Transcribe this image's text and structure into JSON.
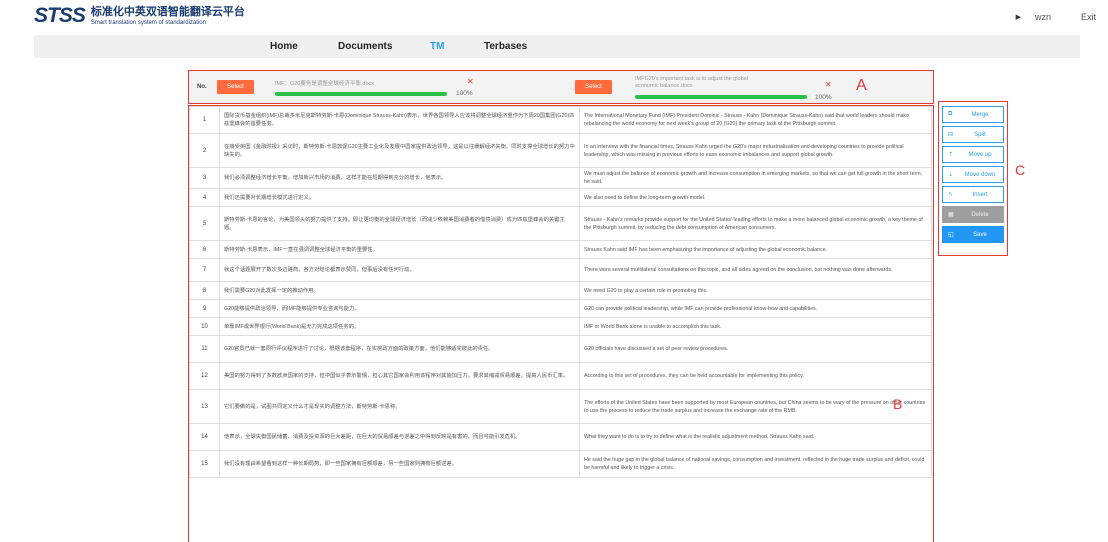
{
  "header": {
    "logo_mark": "STSS",
    "title_cn": "标准化中英双语智能翻译云平台",
    "title_en": "Smart translation system of standardization",
    "user": "wzn",
    "exit_label": "Exit"
  },
  "nav": {
    "items": [
      {
        "label": "Home"
      },
      {
        "label": "Documents"
      },
      {
        "label": "TM"
      },
      {
        "label": "Terbases"
      }
    ],
    "active": "TM"
  },
  "files": {
    "no_label": "No.",
    "source": {
      "select_label": "Select",
      "name": "IMF：G20要务是调整全球经济平衡.docx",
      "progress_text": "100%",
      "progress": 1.0
    },
    "target": {
      "select_label": "Select",
      "name": "IMFG20's important task is to adjust the global economic balance.docx",
      "progress_text": "100%",
      "progress": 1.0
    },
    "annotation": "A"
  },
  "table": {
    "annotation": "B",
    "rows": [
      {
        "no": "1",
        "src": "国际货币基金组织(IMF)总裁多米尼克斯特劳斯-卡恩(Dominique Strauss-Kahn)表示，世界各国领导人应该将调整全球经济重作为下周20国集团(G20)匹兹堡峰会的首要任务。",
        "tgt": "The International Monetary Fund (IMF) President Dominic - Strauss - Kahn (Dominique Strauss-Kahn) said that world leaders should make rebalancing the world economy for next week's group of 20 (G20) the primary task of the Pittsburgh summit."
      },
      {
        "no": "2",
        "src": "在接受英国《金融时报》采访时，斯特劳斯-卡恩敦促G20主要工业化及发展中国家提供政治领导，这是以往缓解经济失衡、同时支撑全球增长的努力中缺失的。",
        "tgt": "In an interview with the financial times, Strauss Kahn urged the G20's major industrialisation and developing countries to provide political leadership, which was missing in previous efforts to ease economic imbalances and support global growth."
      },
      {
        "no": "3",
        "src": "我们必须调整经济增长平衡，增加新兴市场的消费，这样才能在短期得到充分的增长，他表示。",
        "tgt": "We must adjust the balance of economic growth and increase consumption in emerging markets, so that we can get full growth in the short term, he said."
      },
      {
        "no": "4",
        "src": "我们还需要对长期增长模式进行定义。",
        "tgt": "We also need to define the long-term growth model."
      },
      {
        "no": "5",
        "src": "斯特劳斯-卡恩的言论，为美国领头的努力提供了支持，即让更均衡的全球经济增长（而减少依赖美国消费者的借债消费）成为匹兹堡峰会的关键主题。",
        "tgt": "Strauss - Kahn's remarks provide support for the United States' leading efforts to make a more balanced global economic growth, a key theme of the Pittsburgh summit, by reducing the debt consumption of American consumers."
      },
      {
        "no": "6",
        "src": "斯特劳斯-卡恩表示，IMF一直在强调调整全球经济平衡的重要性。",
        "tgt": "Strauss Kahn said IMF has been emphasizing the importance of adjusting the global economic balance."
      },
      {
        "no": "7",
        "src": "就这个话题展开了数次多边磋商，各方对结论都表示赞同，但事后没有任何行动。",
        "tgt": "There were several multilateral consultations on this topic, and all sides agreed on the conclusion, but nothing was done afterwards."
      },
      {
        "no": "8",
        "src": "我们需要G20对此发挥一定的推动作用。",
        "tgt": "We need G20 to play a certain role in promoting this."
      },
      {
        "no": "9",
        "src": "G20能够提供政治领导，而IMF能够提供专业咨询与能力。",
        "tgt": "G20 can provide political leadership, while IMF can provide professional know-how and capabilities."
      },
      {
        "no": "10",
        "src": "单靠IMF或世界银行(World Bank)是无力完成这项任务的。",
        "tgt": "IMF or World Bank alone is unable to accomplish this task."
      },
      {
        "no": "11",
        "src": "G20官员已就一套同行评议程序进行了讨论，根据该套程序，在实施政方面的政策方面，他们能够适完彼此的责任。",
        "tgt": "G20 officials have discussed a set of peer review procedures."
      },
      {
        "no": "12",
        "src": "美国的努力得到了多数欧洲国家的支持，但中国似乎表示警惕，担心其它国家会利用该程序对其施加压力，要求其缩减贸易顺差，提高人民币汇率。",
        "tgt": "According to this set of procedures, they can be held accountable for implementing this policy."
      },
      {
        "no": "13",
        "src": "它们要做的是，试图共同定义什么才是现实的调整方法，斯特劳斯-卡恩称。",
        "tgt": "The efforts of the United States have been supported by most European countries, but China seems to be wary of the pressure on other countries to use the process to reduce the trade surplus and increase the exchange rate of the RMB."
      },
      {
        "no": "14",
        "src": "他表示，全球失衡国民储蓄、消费及投资源的巨大差距，在巨大的贸易顺差与逆差之中得到反映是有害的，而且可能引发危机。",
        "tgt": "What they want to do is to try to define what is the realistic adjustment method, Strauss Kahn said."
      },
      {
        "no": "15",
        "src": "我们没有理由希望看到这样一种长期局势，即一些国家拥有巨额顺差，另一些国家则拥有巨额逆差。",
        "tgt": "He said the huge gap in the global balance of national savings, consumption and investment, reflected in the huge trade surplus and deficit, could be harmful and likely to trigger a crisis."
      }
    ]
  },
  "side": {
    "annotation": "C",
    "buttons": [
      {
        "label": "Merge",
        "icon": "merge-icon",
        "glyph": "⧉"
      },
      {
        "label": "Split",
        "icon": "split-icon",
        "glyph": "⊟"
      },
      {
        "label": "Move up",
        "icon": "move-up-icon",
        "glyph": "⇡"
      },
      {
        "label": "Move down",
        "icon": "move-down-icon",
        "glyph": "⇣"
      },
      {
        "label": "Insert",
        "icon": "insert-icon",
        "glyph": "↖"
      },
      {
        "label": "Delete",
        "icon": "delete-icon",
        "glyph": "▦"
      },
      {
        "label": "Save",
        "icon": "save-icon",
        "glyph": "◱"
      }
    ]
  },
  "colors": {
    "accent": "#2aa3e8",
    "select_button": "#ff6b3d",
    "progress": "#29c14a",
    "annotation": "#e53935"
  }
}
